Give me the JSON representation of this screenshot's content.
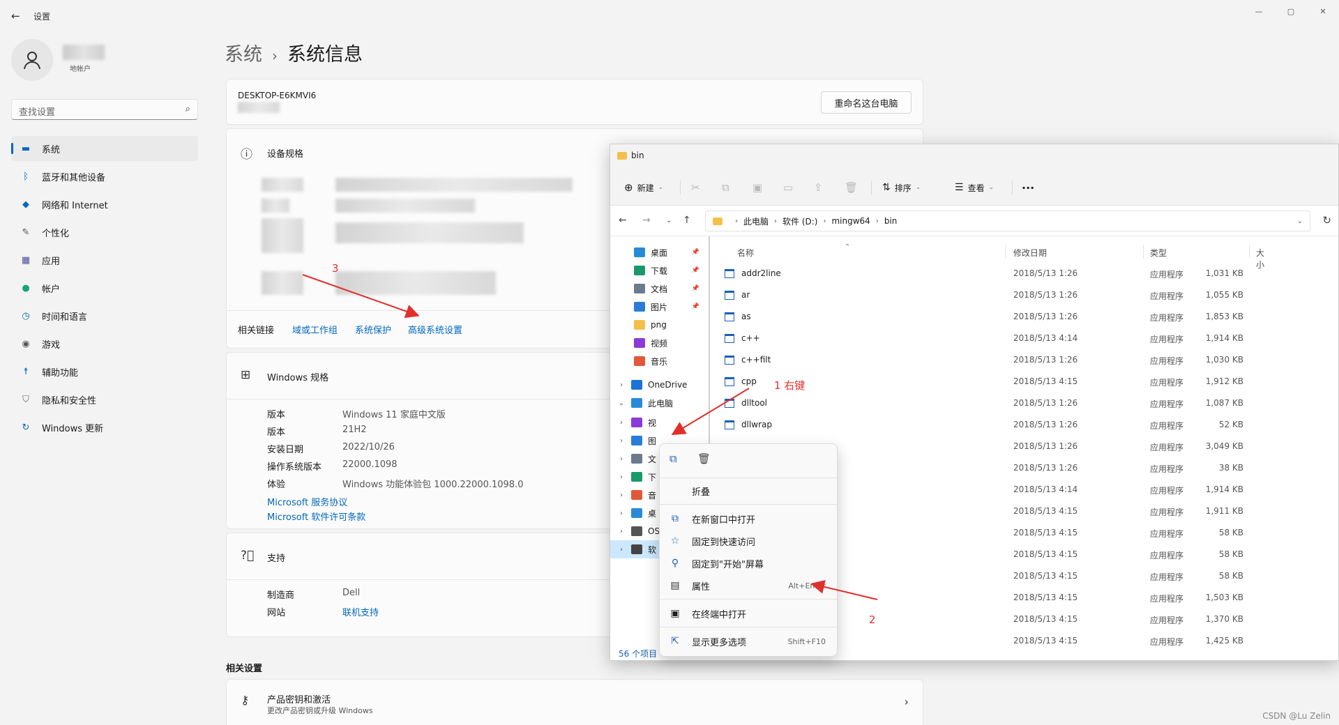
{
  "settings": {
    "title": "设置",
    "account_label": "地帐户",
    "search_placeholder": "查找设置",
    "nav": [
      {
        "label": "系统",
        "icon": "monitor-icon",
        "color": "#0067c0"
      },
      {
        "label": "蓝牙和其他设备",
        "icon": "bluetooth-icon",
        "color": "#0067c0"
      },
      {
        "label": "网络和 Internet",
        "icon": "wifi-icon",
        "color": "#0067c0"
      },
      {
        "label": "个性化",
        "icon": "brush-icon",
        "color": "#555555"
      },
      {
        "label": "应用",
        "icon": "apps-icon",
        "color": "#4a4a9a"
      },
      {
        "label": "帐户",
        "icon": "person-icon",
        "color": "#1aa37a"
      },
      {
        "label": "时间和语言",
        "icon": "globe-clock-icon",
        "color": "#0067c0"
      },
      {
        "label": "游戏",
        "icon": "gamepad-icon",
        "color": "#555555"
      },
      {
        "label": "辅助功能",
        "icon": "accessibility-icon",
        "color": "#0067c0"
      },
      {
        "label": "隐私和安全性",
        "icon": "shield-icon",
        "color": "#666666"
      },
      {
        "label": "Windows 更新",
        "icon": "update-icon",
        "color": "#0067c0"
      }
    ],
    "breadcrumb_parent": "系统",
    "breadcrumb_current": "系统信息",
    "device_name": "DESKTOP-E6KMVI6",
    "rename_button": "重命名这台电脑",
    "device_spec_title": "设备规格",
    "related_links_label": "相关链接",
    "related_links": [
      "域或工作组",
      "系统保护",
      "高级系统设置"
    ],
    "windows_spec_title": "Windows 规格",
    "windows_spec": [
      {
        "label": "版本",
        "value": "Windows 11 家庭中文版"
      },
      {
        "label": "版本",
        "value": "21H2"
      },
      {
        "label": "安装日期",
        "value": "2022/10/26"
      },
      {
        "label": "操作系统版本",
        "value": "22000.1098"
      },
      {
        "label": "体验",
        "value": "Windows 功能体验包 1000.22000.1098.0"
      }
    ],
    "ms_links": [
      "Microsoft 服务协议",
      "Microsoft 软件许可条款"
    ],
    "support_title": "支持",
    "support": [
      {
        "label": "制造商",
        "value": "Dell"
      },
      {
        "label": "网站",
        "value": "联机支持"
      }
    ],
    "related_settings_title": "相关设置",
    "product_key_title": "产品密钥和激活",
    "product_key_sub": "更改产品密钥或升级 Windows"
  },
  "explorer": {
    "title": "bin",
    "toolbar": {
      "new": "新建",
      "sort": "排序",
      "view": "查看",
      "more": "···"
    },
    "address": [
      "此电脑",
      "软件 (D:)",
      "mingw64",
      "bin"
    ],
    "tree": [
      {
        "label": "桌面",
        "pinned": true,
        "color": "#2b8ad8",
        "expand": ""
      },
      {
        "label": "下载",
        "pinned": true,
        "color": "#1a9a6a",
        "expand": ""
      },
      {
        "label": "文档",
        "pinned": true,
        "color": "#6b7b8b",
        "expand": ""
      },
      {
        "label": "图片",
        "pinned": true,
        "color": "#2b7bd8",
        "expand": ""
      },
      {
        "label": "png",
        "pinned": false,
        "color": "#f5c04a",
        "expand": ""
      },
      {
        "label": "视频",
        "pinned": false,
        "color": "#8a3ad8",
        "expand": ""
      },
      {
        "label": "音乐",
        "pinned": false,
        "color": "#e2573a",
        "expand": ""
      },
      {
        "label": "OneDrive",
        "pinned": false,
        "color": "#1a73d8",
        "expand": "›"
      },
      {
        "label": "此电脑",
        "pinned": false,
        "color": "#2b8ad8",
        "expand": "⌄"
      },
      {
        "label": "视",
        "pinned": false,
        "color": "#8a3ad8",
        "expand": "›"
      },
      {
        "label": "图",
        "pinned": false,
        "color": "#2b7bd8",
        "expand": "›"
      },
      {
        "label": "文",
        "pinned": false,
        "color": "#6b7b8b",
        "expand": "›"
      },
      {
        "label": "下",
        "pinned": false,
        "color": "#1a9a6a",
        "expand": "›"
      },
      {
        "label": "音",
        "pinned": false,
        "color": "#e2573a",
        "expand": "›"
      },
      {
        "label": "桌",
        "pinned": false,
        "color": "#2b8ad8",
        "expand": "›"
      },
      {
        "label": "OS",
        "pinned": false,
        "color": "#555555",
        "expand": "›"
      },
      {
        "label": "软",
        "pinned": false,
        "color": "#444444",
        "expand": "›"
      }
    ],
    "columns": {
      "name": "名称",
      "date": "修改日期",
      "type": "类型",
      "size": "大小"
    },
    "files": [
      {
        "name": "addr2line",
        "date": "2018/5/13 1:26",
        "type": "应用程序",
        "size": "1,031 KB"
      },
      {
        "name": "ar",
        "date": "2018/5/13 1:26",
        "type": "应用程序",
        "size": "1,055 KB"
      },
      {
        "name": "as",
        "date": "2018/5/13 1:26",
        "type": "应用程序",
        "size": "1,853 KB"
      },
      {
        "name": "c++",
        "date": "2018/5/13 4:14",
        "type": "应用程序",
        "size": "1,914 KB"
      },
      {
        "name": "c++filt",
        "date": "2018/5/13 1:26",
        "type": "应用程序",
        "size": "1,030 KB"
      },
      {
        "name": "cpp",
        "date": "2018/5/13 4:15",
        "type": "应用程序",
        "size": "1,912 KB"
      },
      {
        "name": "dlltool",
        "date": "2018/5/13 1:26",
        "type": "应用程序",
        "size": "1,087 KB"
      },
      {
        "name": "dllwrap",
        "date": "2018/5/13 1:26",
        "type": "应用程序",
        "size": "52 KB"
      },
      {
        "name": "",
        "date": "2018/5/13 1:26",
        "type": "应用程序",
        "size": "3,049 KB"
      },
      {
        "name": "",
        "date": "2018/5/13 1:26",
        "type": "应用程序",
        "size": "38 KB"
      },
      {
        "name": "",
        "date": "2018/5/13 4:14",
        "type": "应用程序",
        "size": "1,914 KB"
      },
      {
        "name": "",
        "date": "2018/5/13 4:15",
        "type": "应用程序",
        "size": "1,911 KB"
      },
      {
        "name": "",
        "date": "2018/5/13 4:15",
        "type": "应用程序",
        "size": "58 KB"
      },
      {
        "name": "",
        "date": "2018/5/13 4:15",
        "type": "应用程序",
        "size": "58 KB"
      },
      {
        "name": "",
        "date": "2018/5/13 4:15",
        "type": "应用程序",
        "size": "58 KB"
      },
      {
        "name": "",
        "date": "2018/5/13 4:15",
        "type": "应用程序",
        "size": "1,503 KB"
      },
      {
        "name": "",
        "date": "2018/5/13 4:15",
        "type": "应用程序",
        "size": "1,370 KB"
      },
      {
        "name": "",
        "date": "2018/5/13 4:15",
        "type": "应用程序",
        "size": "1,425 KB"
      }
    ],
    "status": "56 个项目"
  },
  "context_menu": {
    "collapse": "折叠",
    "open_new_window": "在新窗口中打开",
    "pin_quick_access": "固定到快速访问",
    "pin_start": "固定到\"开始\"屏幕",
    "properties": "属性",
    "properties_shortcut": "Alt+Enter",
    "open_terminal": "在终端中打开",
    "more_options": "显示更多选项",
    "more_options_shortcut": "Shift+F10"
  },
  "annotations": {
    "step1": "1 右键",
    "step2": "2",
    "step3": "3"
  },
  "watermark": "CSDN @Lu Zelin"
}
